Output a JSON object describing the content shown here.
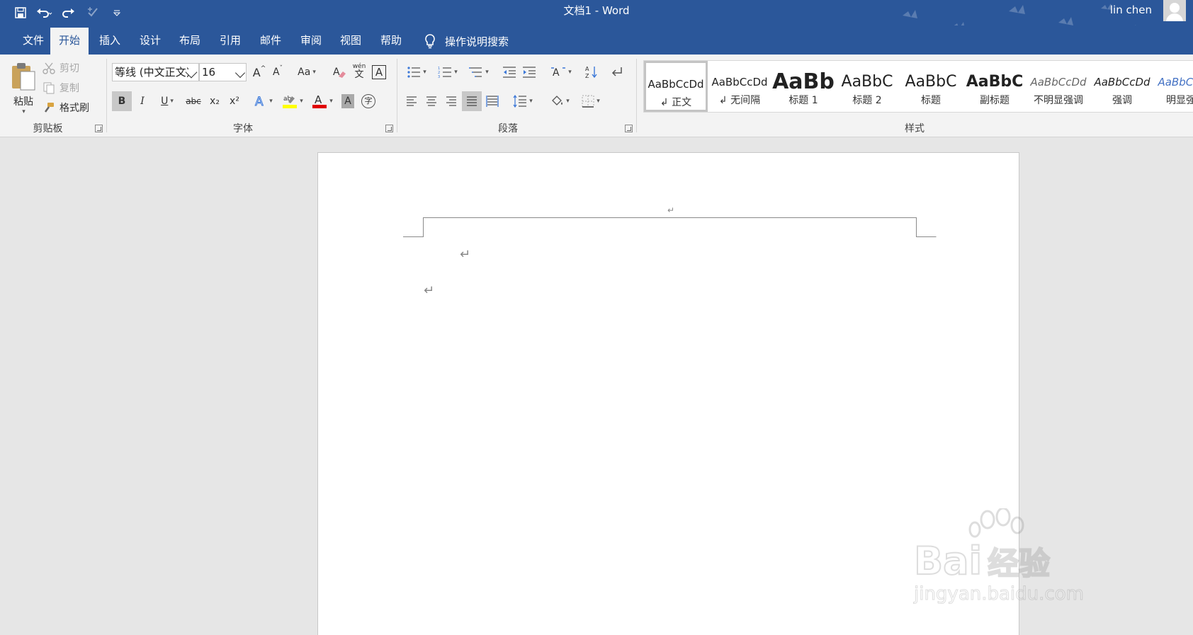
{
  "window": {
    "title": "文档1  -  Word",
    "user": "lin chen"
  },
  "quick_access": {
    "save_icon": "save-icon",
    "undo_icon": "undo-icon",
    "redo_icon": "redo-icon",
    "touch_mode_icon": "touch-mode-icon",
    "customize_icon": "customize-qat-icon"
  },
  "tabs": [
    {
      "label": "文件"
    },
    {
      "label": "开始",
      "active": true
    },
    {
      "label": "插入"
    },
    {
      "label": "设计"
    },
    {
      "label": "布局"
    },
    {
      "label": "引用"
    },
    {
      "label": "邮件"
    },
    {
      "label": "审阅"
    },
    {
      "label": "视图"
    },
    {
      "label": "帮助"
    }
  ],
  "tell_me": {
    "label": "操作说明搜索",
    "icon": "lightbulb-icon"
  },
  "clipboard": {
    "group": "剪贴板",
    "paste": "粘贴",
    "cut": "剪切",
    "copy": "复制",
    "format_painter": "格式刷"
  },
  "font": {
    "group": "字体",
    "font_name": "等线 (中文正文)",
    "font_size": "16",
    "change_case": "Aa",
    "bold": "B",
    "italic": "I",
    "underline": "U",
    "strikethrough": "abc",
    "subscript": "x₂",
    "superscript": "x²",
    "phonetic_top": "wén",
    "phonetic_bottom": "文",
    "enclose_char": "字",
    "highlight_color": "#ffff00",
    "font_color": "#e00000"
  },
  "paragraph": {
    "group": "段落"
  },
  "styles": {
    "group": "样式",
    "items": [
      {
        "preview": "AaBbCcDd",
        "name": "正文",
        "selected": true
      },
      {
        "preview": "AaBbCcDd",
        "name": "无间隔"
      },
      {
        "preview": "AaBb",
        "name": "标题 1"
      },
      {
        "preview": "AaBbC",
        "name": "标题 2"
      },
      {
        "preview": "AaBbC",
        "name": "标题"
      },
      {
        "preview": "AaBbC",
        "name": "副标题"
      },
      {
        "preview": "AaBbCcDd",
        "name": "不明显强调"
      },
      {
        "preview": "AaBbCcDd",
        "name": "强调"
      },
      {
        "preview": "AaBbCcDd",
        "name": "明显强调"
      }
    ]
  },
  "document": {
    "paragraph_mark": "↵"
  },
  "watermark": {
    "brand": "Bai",
    "brand_cn": "经验",
    "url": "jingyan.baidu.com"
  },
  "colors": {
    "title_bar": "#2b579a",
    "ribbon": "#f3f3f3",
    "workspace": "#e6e6e6"
  }
}
